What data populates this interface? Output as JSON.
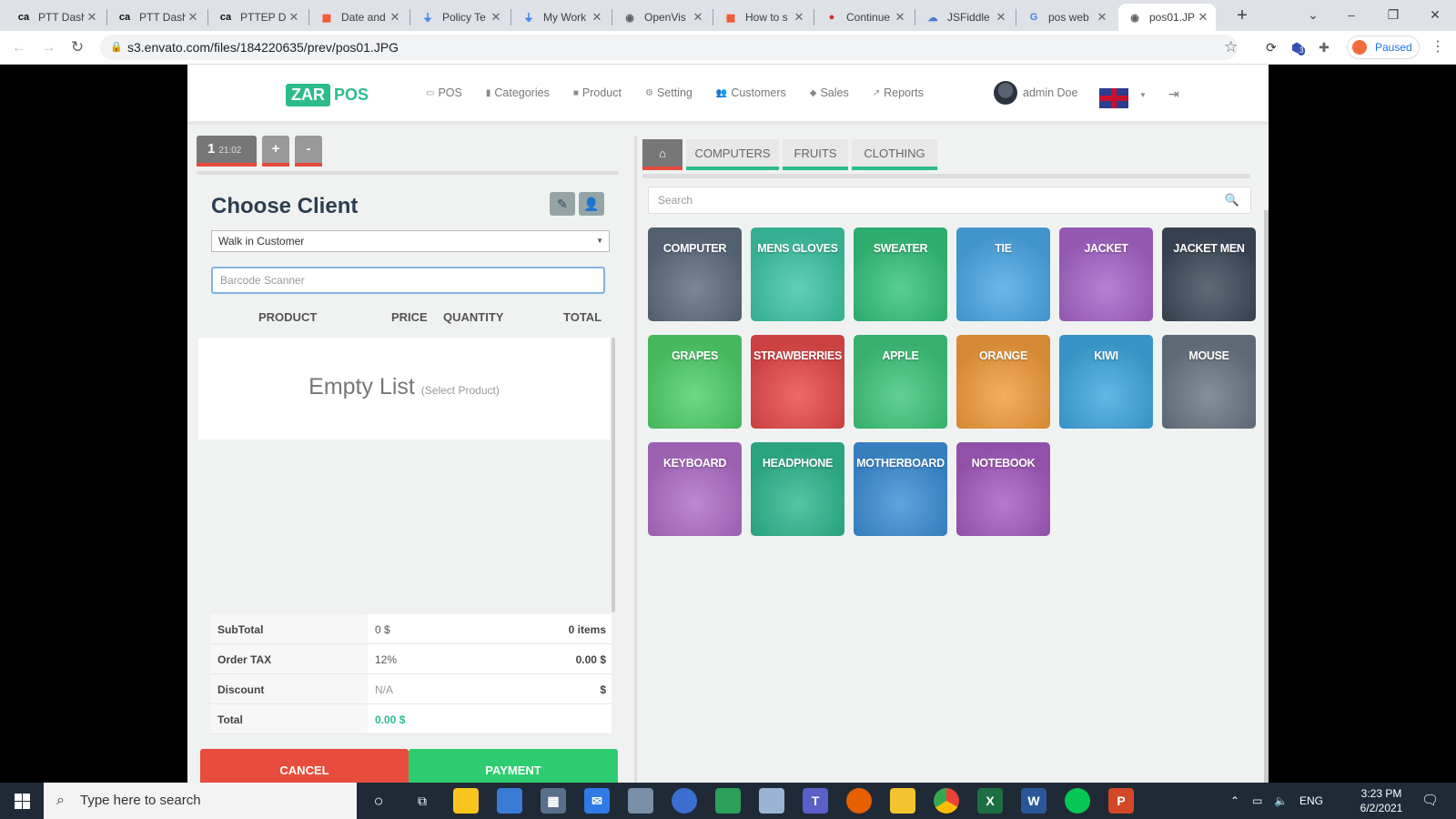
{
  "browser": {
    "tabs": [
      {
        "title": "PTT Dash",
        "favicon": "ca-icon"
      },
      {
        "title": "PTT Dash",
        "favicon": "ca-icon"
      },
      {
        "title": "PTTEP D",
        "favicon": "ca-icon"
      },
      {
        "title": "Date and",
        "favicon": "ms-icon"
      },
      {
        "title": "Policy Te",
        "favicon": "plug-icon"
      },
      {
        "title": "My Work",
        "favicon": "plug-icon"
      },
      {
        "title": "OpenVis",
        "favicon": "globe-icon"
      },
      {
        "title": "How to s",
        "favicon": "ms-icon"
      },
      {
        "title": "Continue",
        "favicon": "drop-icon"
      },
      {
        "title": "JSFiddle",
        "favicon": "cloud-icon"
      },
      {
        "title": "pos web",
        "favicon": "google-icon"
      },
      {
        "title": "pos01.JP",
        "favicon": "globe-icon"
      }
    ],
    "url": "s3.envato.com/files/184220635/prev/pos01.JPG",
    "profile_status": "Paused",
    "extension_badge": "3"
  },
  "app": {
    "logo_left": "ZAR",
    "logo_right": "POS",
    "nav": [
      {
        "label": "POS",
        "icon": "card-icon"
      },
      {
        "label": "Categories",
        "icon": "bookmark-icon"
      },
      {
        "label": "Product",
        "icon": "box-icon"
      },
      {
        "label": "Setting",
        "icon": "gears-icon"
      },
      {
        "label": "Customers",
        "icon": "users-icon"
      },
      {
        "label": "Sales",
        "icon": "tag-icon"
      },
      {
        "label": "Reports",
        "icon": "chart-icon"
      }
    ],
    "user_name": "admin Doe"
  },
  "order": {
    "number": "1",
    "time": "21:02",
    "add_label": "+",
    "remove_label": "-"
  },
  "client": {
    "title": "Choose Client",
    "selected": "Walk in Customer",
    "barcode_placeholder": "Barcode Scanner"
  },
  "cart": {
    "columns": [
      "PRODUCT",
      "PRICE",
      "QUANTITY",
      "TOTAL"
    ],
    "empty_main": "Empty List",
    "empty_hint": "(Select Product)"
  },
  "summary": {
    "subtotal_label": "SubTotal",
    "subtotal_value": "0 $",
    "subtotal_items": "0 items",
    "tax_label": "Order TAX",
    "tax_rate": "12%",
    "tax_value": "0.00 $",
    "discount_label": "Discount",
    "discount_value": "N/A",
    "discount_unit": "$",
    "total_label": "Total",
    "total_value": "0.00 $"
  },
  "actions": {
    "cancel": "CANCEL",
    "payment": "PAYMENT"
  },
  "categories": [
    "COMPUTERS",
    "FRUITS",
    "CLOTHING"
  ],
  "product_search_placeholder": "Search",
  "products": [
    {
      "name": "COMPUTER",
      "color": "#5d6d7e"
    },
    {
      "name": "MENS GLOVES",
      "color": "#3ec7a5"
    },
    {
      "name": "SWEATER",
      "color": "#34c47c"
    },
    {
      "name": "TIE",
      "color": "#4aa8e8"
    },
    {
      "name": "JACKET",
      "color": "#a765c9"
    },
    {
      "name": "JACKET MEN",
      "color": "#3e4a5a"
    },
    {
      "name": "GRAPES",
      "color": "#4fd06a"
    },
    {
      "name": "STRAWBERRIES",
      "color": "#e84a4a"
    },
    {
      "name": "APPLE",
      "color": "#3fc77c"
    },
    {
      "name": "ORANGE",
      "color": "#f39c3c"
    },
    {
      "name": "KIWI",
      "color": "#3fa7e0"
    },
    {
      "name": "MOUSE",
      "color": "#6b7786"
    },
    {
      "name": "KEYBOARD",
      "color": "#b06ec8"
    },
    {
      "name": "HEADPHONE",
      "color": "#2fb890"
    },
    {
      "name": "MOTHERBOARD",
      "color": "#3d8fd8"
    },
    {
      "name": "NOTEBOOK",
      "color": "#a65cc0"
    }
  ],
  "taskbar": {
    "search_placeholder": "Type here to search",
    "language": "ENG",
    "time": "3:23 PM",
    "date": "6/2/2021"
  }
}
